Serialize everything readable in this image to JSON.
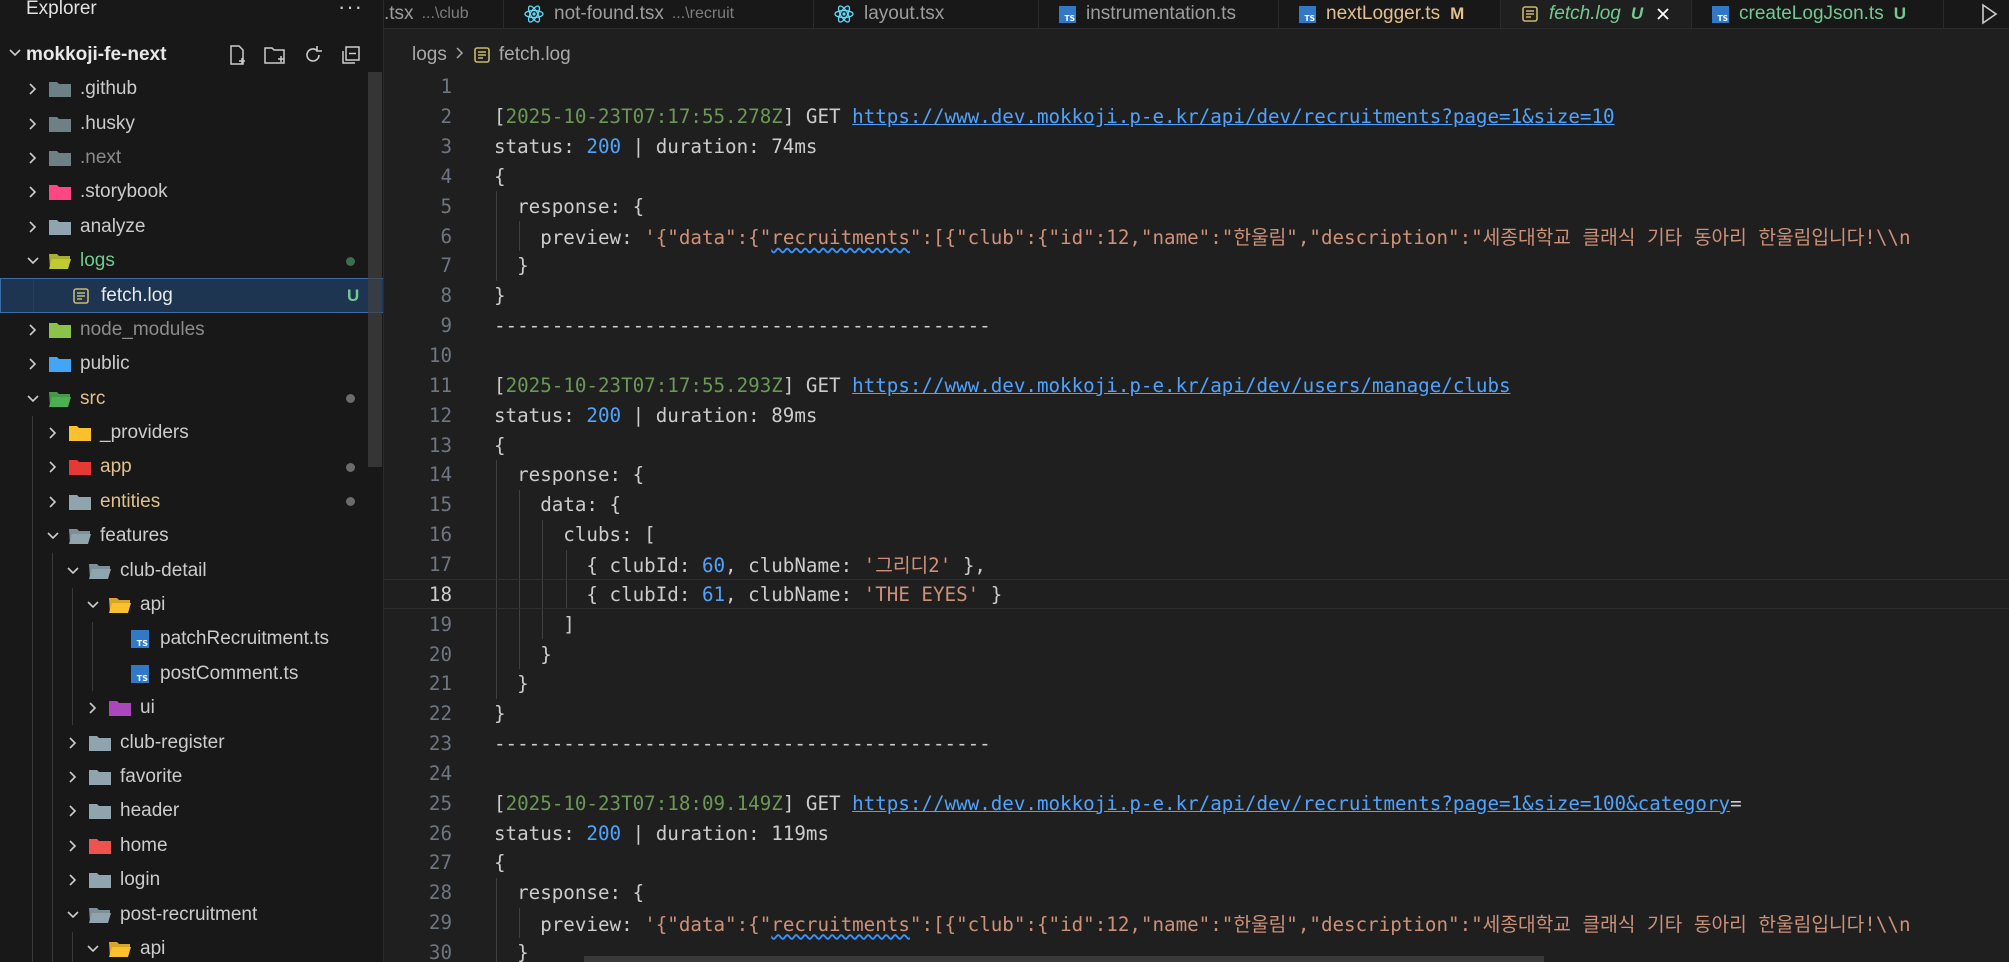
{
  "explorer": {
    "title": "Explorer",
    "more": "···",
    "workspace": "mokkoji-fe-next"
  },
  "tree": [
    {
      "label": ".github",
      "kind": "folder",
      "icon": "github-folder-icon",
      "open": false,
      "depth": 0
    },
    {
      "label": ".husky",
      "kind": "folder",
      "icon": "husky-folder-icon",
      "open": false,
      "depth": 0
    },
    {
      "label": ".next",
      "kind": "folder",
      "icon": "next-folder-icon",
      "open": false,
      "depth": 0,
      "dim": true
    },
    {
      "label": ".storybook",
      "kind": "folder",
      "icon": "storybook-folder-icon",
      "open": false,
      "depth": 0
    },
    {
      "label": "analyze",
      "kind": "folder",
      "icon": "folder-icon",
      "open": false,
      "depth": 0
    },
    {
      "label": "logs",
      "kind": "folder",
      "icon": "logs-folder-icon",
      "open": true,
      "depth": 0,
      "color": "green",
      "dot": "green"
    },
    {
      "label": "fetch.log",
      "kind": "file",
      "icon": "log-file-icon",
      "depth": 1,
      "selected": true,
      "badge": "U"
    },
    {
      "label": "node_modules",
      "kind": "folder",
      "icon": "node-folder-icon",
      "open": false,
      "depth": 0,
      "dim": true
    },
    {
      "label": "public",
      "kind": "folder",
      "icon": "public-folder-icon",
      "open": false,
      "depth": 0
    },
    {
      "label": "src",
      "kind": "folder",
      "icon": "src-folder-icon",
      "open": true,
      "depth": 0,
      "color": "orange",
      "dot": "grey"
    },
    {
      "label": "_providers",
      "kind": "folder",
      "icon": "providers-folder-icon",
      "open": false,
      "depth": 1
    },
    {
      "label": "app",
      "kind": "folder",
      "icon": "app-folder-icon",
      "open": false,
      "depth": 1,
      "color": "orange",
      "dot": "grey"
    },
    {
      "label": "entities",
      "kind": "folder",
      "icon": "folder-icon",
      "open": false,
      "depth": 1,
      "color": "orange",
      "dot": "grey"
    },
    {
      "label": "features",
      "kind": "folder",
      "icon": "folder-open-icon",
      "open": true,
      "depth": 1
    },
    {
      "label": "club-detail",
      "kind": "folder",
      "icon": "folder-open-icon",
      "open": true,
      "depth": 2
    },
    {
      "label": "api",
      "kind": "folder",
      "icon": "api-folder-icon",
      "open": true,
      "depth": 3
    },
    {
      "label": "patchRecruitment.ts",
      "kind": "file",
      "icon": "ts-file-icon",
      "depth": 4
    },
    {
      "label": "postComment.ts",
      "kind": "file",
      "icon": "ts-file-icon",
      "depth": 4
    },
    {
      "label": "ui",
      "kind": "folder",
      "icon": "ui-folder-icon",
      "open": false,
      "depth": 3
    },
    {
      "label": "club-register",
      "kind": "folder",
      "icon": "folder-icon",
      "open": false,
      "depth": 2
    },
    {
      "label": "favorite",
      "kind": "folder",
      "icon": "folder-icon",
      "open": false,
      "depth": 2
    },
    {
      "label": "header",
      "kind": "folder",
      "icon": "folder-icon",
      "open": false,
      "depth": 2
    },
    {
      "label": "home",
      "kind": "folder",
      "icon": "home-folder-icon",
      "open": false,
      "depth": 2
    },
    {
      "label": "login",
      "kind": "folder",
      "icon": "folder-icon",
      "open": false,
      "depth": 2
    },
    {
      "label": "post-recruitment",
      "kind": "folder",
      "icon": "folder-open-icon",
      "open": true,
      "depth": 2
    },
    {
      "label": "api",
      "kind": "folder",
      "icon": "api-folder-icon",
      "open": true,
      "depth": 3
    }
  ],
  "tabs": [
    {
      "label": ".tsx",
      "path": "...\\club",
      "icon": "none"
    },
    {
      "label": "not-found.tsx",
      "path": "...\\recruit",
      "icon": "react-icon"
    },
    {
      "label": "layout.tsx",
      "path": "",
      "icon": "react-icon"
    },
    {
      "label": "instrumentation.ts",
      "path": "",
      "icon": "ts-icon"
    },
    {
      "label": "nextLogger.ts",
      "mark": "M",
      "icon": "ts-icon",
      "color": "#e2c08d"
    },
    {
      "label": "fetch.log",
      "mark": "U",
      "icon": "log-icon",
      "active": true
    },
    {
      "label": "createLogJson.ts",
      "mark": "U",
      "icon": "ts-icon",
      "color": "#73c991"
    }
  ],
  "breadcrumb": {
    "folder": "logs",
    "file": "fetch.log"
  },
  "editor": {
    "current_line": 18,
    "lines": [
      [],
      [
        [
          "[",
          "br"
        ],
        [
          "2025-10-23T07:17:55.278Z",
          "time"
        ],
        [
          "] GET ",
          "br"
        ],
        [
          "https://www.dev.mokkoji.p-e.kr/api/dev/recruitments?page=1&size=10",
          "url"
        ]
      ],
      [
        [
          "status: ",
          "br"
        ],
        [
          "200",
          "num"
        ],
        [
          " | duration: 74ms",
          "br"
        ]
      ],
      [
        [
          "{",
          "br"
        ]
      ],
      [
        [
          "  response: {",
          "br"
        ]
      ],
      [
        [
          "    preview: ",
          "br"
        ],
        [
          "'{\"data\":{\"",
          "str"
        ],
        [
          "recruitments",
          "str sq"
        ],
        [
          "\":[{\"club\":{\"id\":12,\"name\":\"한울림\",\"description\":\"세종대학교 클래식 기타 동아리 한울림입니다!\\\\n",
          "str"
        ]
      ],
      [
        [
          "  }",
          "br"
        ]
      ],
      [
        [
          "}",
          "br"
        ]
      ],
      [
        [
          "-------------------------------------------",
          "br"
        ]
      ],
      [],
      [
        [
          "[",
          "br"
        ],
        [
          "2025-10-23T07:17:55.293Z",
          "time"
        ],
        [
          "] GET ",
          "br"
        ],
        [
          "https://www.dev.mokkoji.p-e.kr/api/dev/users/manage/clubs",
          "url"
        ]
      ],
      [
        [
          "status: ",
          "br"
        ],
        [
          "200",
          "num"
        ],
        [
          " | duration: 89ms",
          "br"
        ]
      ],
      [
        [
          "{",
          "br"
        ]
      ],
      [
        [
          "  response: {",
          "br"
        ]
      ],
      [
        [
          "    data: {",
          "br"
        ]
      ],
      [
        [
          "      clubs: [",
          "br"
        ]
      ],
      [
        [
          "        { clubId: ",
          "br"
        ],
        [
          "60",
          "num"
        ],
        [
          ", clubName: ",
          "br"
        ],
        [
          "'그리디2'",
          "str"
        ],
        [
          " },",
          "br"
        ]
      ],
      [
        [
          "        { clubId: ",
          "br"
        ],
        [
          "61",
          "num"
        ],
        [
          ", clubName: ",
          "br"
        ],
        [
          "'THE EYES'",
          "str"
        ],
        [
          " }",
          "br"
        ]
      ],
      [
        [
          "      ]",
          "br"
        ]
      ],
      [
        [
          "    }",
          "br"
        ]
      ],
      [
        [
          "  }",
          "br"
        ]
      ],
      [
        [
          "}",
          "br"
        ]
      ],
      [
        [
          "-------------------------------------------",
          "br"
        ]
      ],
      [],
      [
        [
          "[",
          "br"
        ],
        [
          "2025-10-23T07:18:09.149Z",
          "time"
        ],
        [
          "] GET ",
          "br"
        ],
        [
          "https://www.dev.mokkoji.p-e.kr/api/dev/recruitments?page=1&size=100&category",
          "url"
        ],
        [
          "=",
          "br"
        ]
      ],
      [
        [
          "status: ",
          "br"
        ],
        [
          "200",
          "num"
        ],
        [
          " | duration: 119ms",
          "br"
        ]
      ],
      [
        [
          "{",
          "br"
        ]
      ],
      [
        [
          "  response: {",
          "br"
        ]
      ],
      [
        [
          "    preview: ",
          "br"
        ],
        [
          "'{\"data\":{\"",
          "str"
        ],
        [
          "recruitments",
          "str sq"
        ],
        [
          "\":[{\"club\":{\"id\":12,\"name\":\"한울림\",\"description\":\"세종대학교 클래식 기타 동아리 한울림입니다!\\\\n",
          "str"
        ]
      ],
      [
        [
          "  }",
          "br"
        ]
      ]
    ]
  }
}
